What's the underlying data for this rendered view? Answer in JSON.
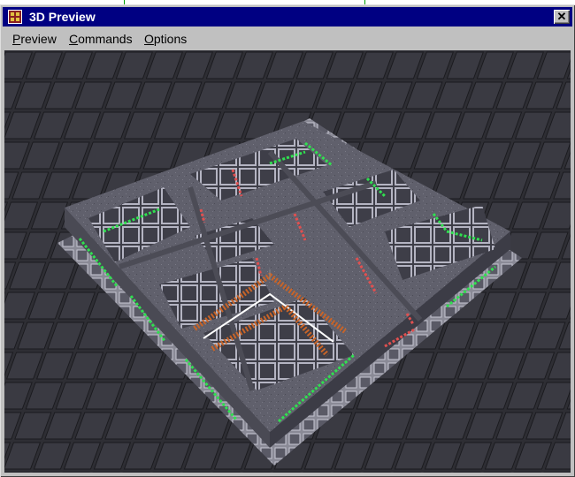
{
  "window": {
    "title": "3D Preview",
    "titlebar_color": "#000082",
    "close_label": "✕",
    "app_icon": "jed-app-icon"
  },
  "menubar": {
    "items": [
      {
        "label": "Preview",
        "mnemonic": "P"
      },
      {
        "label": "Commands",
        "mnemonic": "C"
      },
      {
        "label": "Options",
        "mnemonic": "O"
      }
    ]
  },
  "viewport": {
    "background": "#2c2c30",
    "floor_color": "#9a9aa6",
    "wall_color": "#5c5c66",
    "accent_green": "#30e050",
    "accent_red": "#e05050",
    "accent_orange": "#c86428"
  }
}
